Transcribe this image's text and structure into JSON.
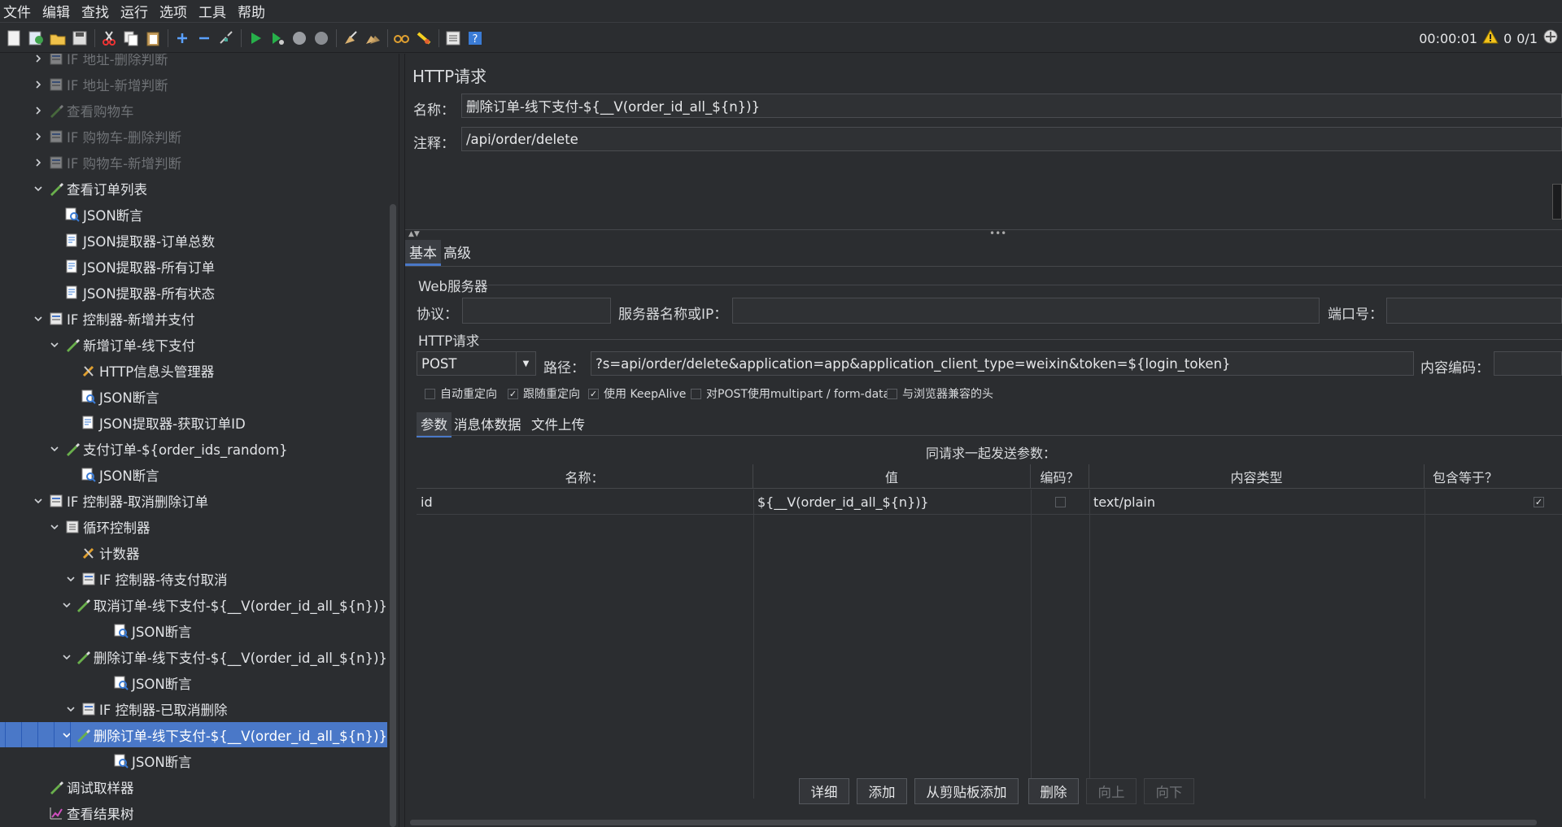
{
  "menu": [
    "文件",
    "编辑",
    "查找",
    "运行",
    "选项",
    "工具",
    "帮助"
  ],
  "toolbar": {
    "timer": "00:00:01",
    "warn_count": "0",
    "threads": "0/1"
  },
  "tree": [
    {
      "label": "IF 地址-删除判断",
      "depth": 1,
      "chev": "right",
      "icon": "if-controller-icon",
      "dim": true
    },
    {
      "label": "IF 地址-新增判断",
      "depth": 1,
      "chev": "right",
      "icon": "if-controller-icon",
      "dim": true
    },
    {
      "label": "查看购物车",
      "depth": 1,
      "chev": "right",
      "icon": "sampler-pen-icon",
      "dim": true
    },
    {
      "label": "IF 购物车-删除判断",
      "depth": 1,
      "chev": "right",
      "icon": "if-controller-icon",
      "dim": true
    },
    {
      "label": "IF 购物车-新增判断",
      "depth": 1,
      "chev": "right",
      "icon": "if-controller-icon",
      "dim": true
    },
    {
      "label": "查看订单列表",
      "depth": 1,
      "chev": "down",
      "icon": "sampler-pen-icon"
    },
    {
      "label": "JSON断言",
      "depth": 2,
      "chev": "",
      "icon": "assertion-icon"
    },
    {
      "label": "JSON提取器-订单总数",
      "depth": 2,
      "chev": "",
      "icon": "extractor-icon"
    },
    {
      "label": "JSON提取器-所有订单",
      "depth": 2,
      "chev": "",
      "icon": "extractor-icon"
    },
    {
      "label": "JSON提取器-所有状态",
      "depth": 2,
      "chev": "",
      "icon": "extractor-icon"
    },
    {
      "label": "IF 控制器-新增并支付",
      "depth": 1,
      "chev": "down",
      "icon": "if-controller-icon"
    },
    {
      "label": "新增订单-线下支付",
      "depth": 2,
      "chev": "down",
      "icon": "sampler-pen-icon"
    },
    {
      "label": "HTTP信息头管理器",
      "depth": 3,
      "chev": "",
      "icon": "config-tools-icon"
    },
    {
      "label": "JSON断言",
      "depth": 3,
      "chev": "",
      "icon": "assertion-icon"
    },
    {
      "label": "JSON提取器-获取订单ID",
      "depth": 3,
      "chev": "",
      "icon": "extractor-icon"
    },
    {
      "label": "支付订单-${order_ids_random}",
      "depth": 2,
      "chev": "down",
      "icon": "sampler-pen-icon"
    },
    {
      "label": "JSON断言",
      "depth": 3,
      "chev": "",
      "icon": "assertion-icon"
    },
    {
      "label": "IF 控制器-取消删除订单",
      "depth": 1,
      "chev": "down",
      "icon": "if-controller-icon"
    },
    {
      "label": "循环控制器",
      "depth": 2,
      "chev": "down",
      "icon": "loop-controller-icon"
    },
    {
      "label": "计数器",
      "depth": 3,
      "chev": "",
      "icon": "config-tools-icon"
    },
    {
      "label": "IF 控制器-待支付取消",
      "depth": 3,
      "chev": "down",
      "icon": "if-controller-icon"
    },
    {
      "label": "取消订单-线下支付-${__V(order_id_all_${n})}",
      "depth": 4,
      "chev": "down",
      "icon": "sampler-pen-icon"
    },
    {
      "label": "JSON断言",
      "depth": 5,
      "chev": "",
      "icon": "assertion-icon"
    },
    {
      "label": "删除订单-线下支付-${__V(order_id_all_${n})}",
      "depth": 4,
      "chev": "down",
      "icon": "sampler-pen-icon"
    },
    {
      "label": "JSON断言",
      "depth": 5,
      "chev": "",
      "icon": "assertion-icon"
    },
    {
      "label": "IF 控制器-已取消删除",
      "depth": 3,
      "chev": "down",
      "icon": "if-controller-icon"
    },
    {
      "label": "删除订单-线下支付-${__V(order_id_all_${n})}",
      "depth": 4,
      "chev": "down",
      "icon": "sampler-pen-icon",
      "selected": true
    },
    {
      "label": "JSON断言",
      "depth": 5,
      "chev": "",
      "icon": "assertion-icon"
    },
    {
      "label": "调试取样器",
      "depth": 1,
      "chev": "",
      "icon": "sampler-pen-icon"
    },
    {
      "label": "查看结果树",
      "depth": 1,
      "chev": "",
      "icon": "listener-chart-icon"
    }
  ],
  "panel": {
    "title": "HTTP请求",
    "name_label": "名称：",
    "name_value": "删除订单-线下支付-${__V(order_id_all_${n})}",
    "comment_label": "注释：",
    "comment_value": "/api/order/delete",
    "tabs": [
      "基本",
      "高级"
    ],
    "web_server_section": "Web服务器",
    "protocol_label": "协议：",
    "protocol_value": "",
    "server_label": "服务器名称或IP：",
    "server_value": "",
    "port_label": "端口号：",
    "port_value": "",
    "http_section": "HTTP请求",
    "method": "POST",
    "path_label": "路径：",
    "path_value": "?s=api/order/delete&application=app&application_client_type=weixin&token=${login_token}",
    "encoding_label": "内容编码：",
    "encoding_value": "",
    "checkboxes": [
      {
        "label": "自动重定向",
        "checked": false
      },
      {
        "label": "跟随重定向",
        "checked": true
      },
      {
        "label": "使用 KeepAlive",
        "checked": true
      },
      {
        "label": "对POST使用multipart / form-data",
        "checked": false
      },
      {
        "label": "与浏览器兼容的头",
        "checked": false
      }
    ],
    "sub_tabs": [
      "参数",
      "消息体数据",
      "文件上传"
    ],
    "table_caption": "同请求一起发送参数：",
    "table_headers": [
      "名称：",
      "值",
      "编码？",
      "内容类型",
      "包含等于？"
    ],
    "table_rows": [
      {
        "name": "id",
        "value": "${__V(order_id_all_${n})}",
        "encode": false,
        "content_type": "text/plain",
        "include_equals": true
      }
    ],
    "buttons": [
      {
        "label": "详细",
        "enabled": true
      },
      {
        "label": "添加",
        "enabled": true
      },
      {
        "label": "从剪贴板添加",
        "enabled": true
      },
      {
        "label": "删除",
        "enabled": true
      },
      {
        "label": "向上",
        "enabled": false
      },
      {
        "label": "向下",
        "enabled": false
      }
    ]
  }
}
